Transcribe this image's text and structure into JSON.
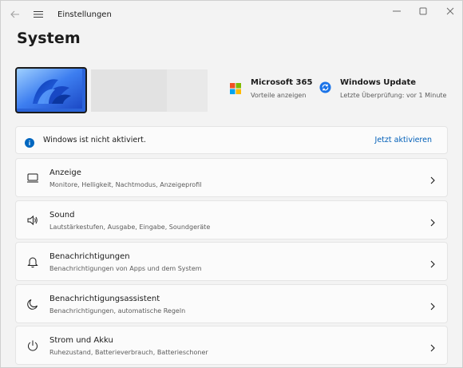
{
  "app": {
    "title": "Einstellungen"
  },
  "page": {
    "title": "System"
  },
  "colors": {
    "accent": "#005fb8",
    "background": "#f3f3f3",
    "card": "#fbfbfb"
  },
  "tiles": {
    "microsoft365": {
      "title": "Microsoft 365",
      "subtitle": "Vorteile anzeigen",
      "icon": "microsoft-logo-icon"
    },
    "windows_update": {
      "title": "Windows Update",
      "subtitle": "Letzte Überprüfung: vor 1 Minute",
      "icon": "sync-icon"
    }
  },
  "activation": {
    "message": "Windows ist nicht aktiviert.",
    "action": "Jetzt aktivieren",
    "icon": "info-icon"
  },
  "settings": [
    {
      "title": "Anzeige",
      "subtitle": "Monitore, Helligkeit, Nachtmodus, Anzeigeprofil",
      "icon": "monitor-icon"
    },
    {
      "title": "Sound",
      "subtitle": "Lautstärkestufen, Ausgabe, Eingabe, Soundgeräte",
      "icon": "speaker-icon"
    },
    {
      "title": "Benachrichtigungen",
      "subtitle": "Benachrichtigungen von Apps und dem System",
      "icon": "bell-icon"
    },
    {
      "title": "Benachrichtigungsassistent",
      "subtitle": "Benachrichtigungen, automatische Regeln",
      "icon": "moon-icon"
    },
    {
      "title": "Strom und Akku",
      "subtitle": "Ruhezustand, Batterieverbrauch, Batterieschoner",
      "icon": "power-icon"
    }
  ]
}
